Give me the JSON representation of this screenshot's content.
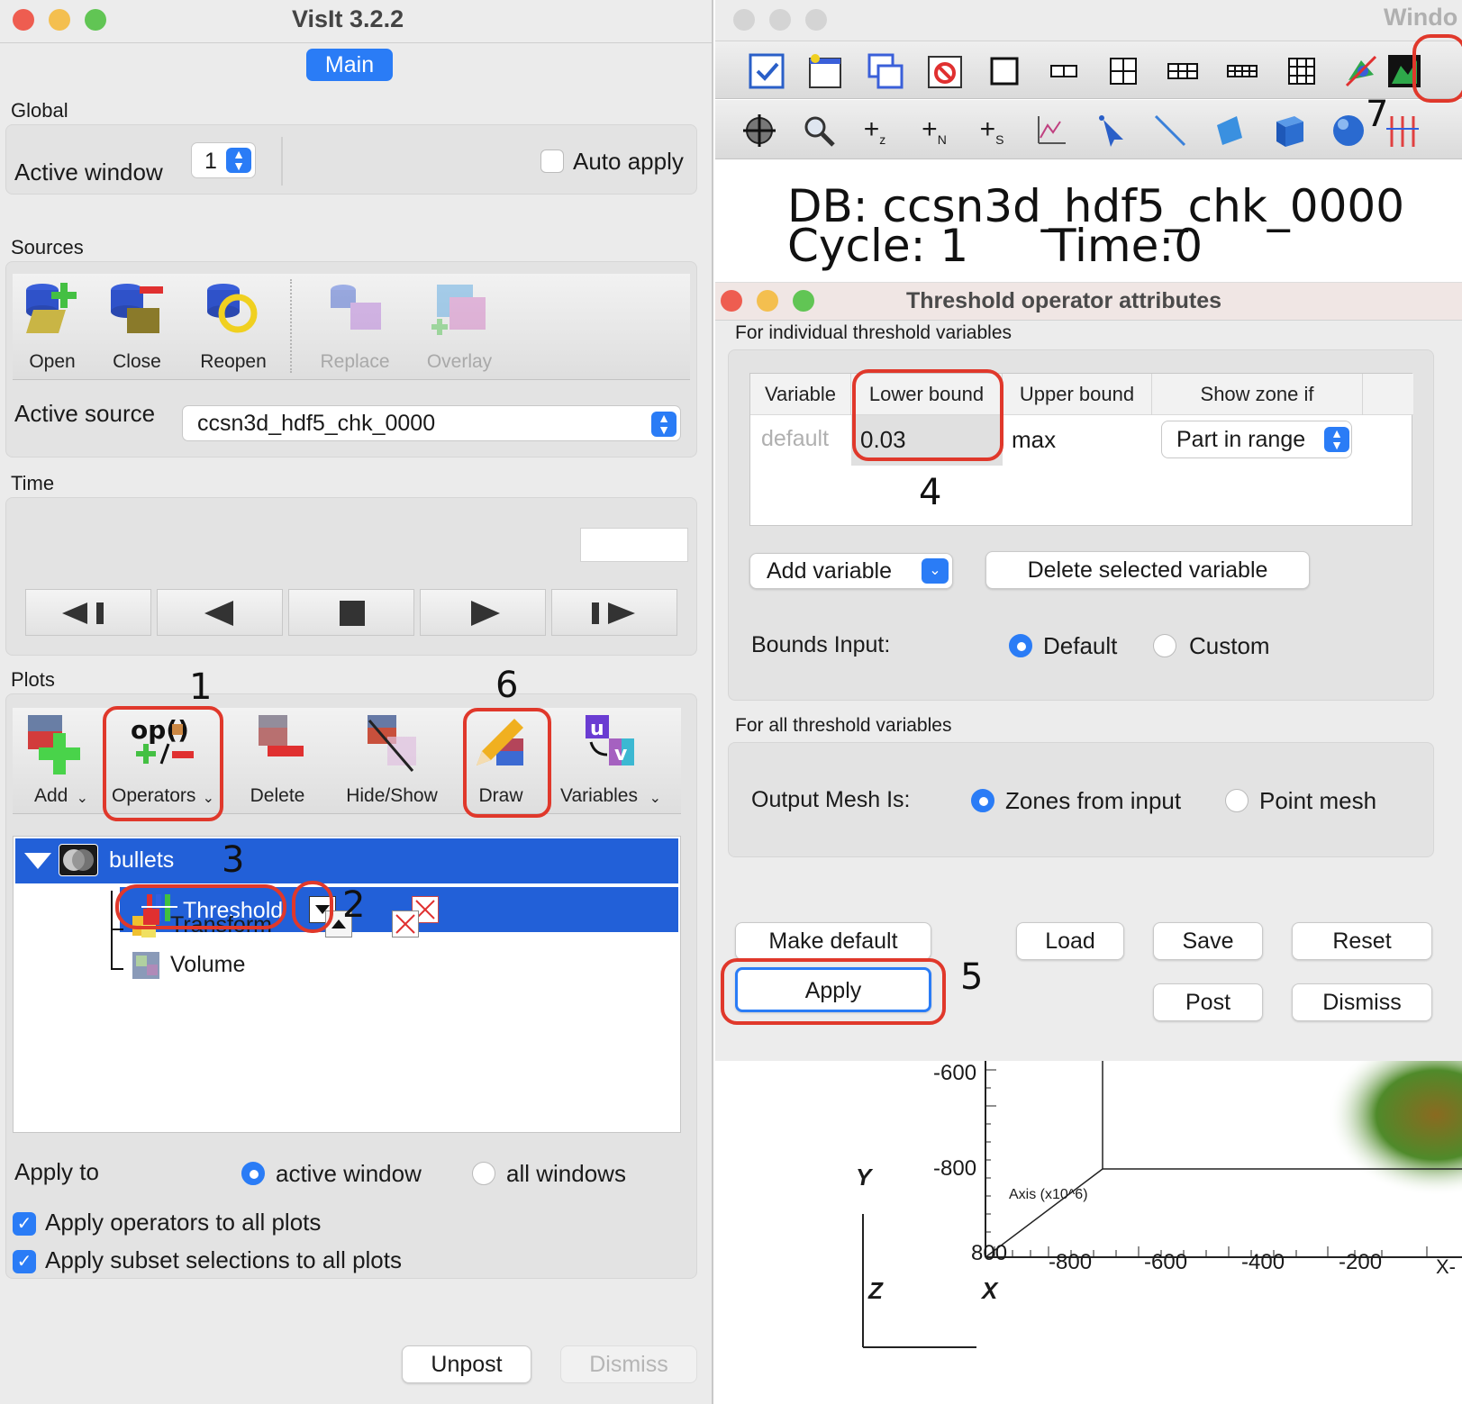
{
  "main_window": {
    "title": "VisIt 3.2.2",
    "tab": "Main",
    "global_label": "Global",
    "active_window_label": "Active window",
    "active_window_value": "1",
    "auto_apply_label": "Auto apply",
    "sources_label": "Sources",
    "sources_buttons": {
      "open": "Open",
      "close": "Close",
      "reopen": "Reopen",
      "replace": "Replace",
      "overlay": "Overlay"
    },
    "active_source_label": "Active source",
    "active_source_value": "ccsn3d_hdf5_chk_0000",
    "time_label": "Time",
    "plots_label": "Plots",
    "plot_buttons": {
      "add": "Add",
      "operators": "Operators",
      "delete": "Delete",
      "hideshow": "Hide/Show",
      "draw": "Draw",
      "variables": "Variables"
    },
    "plot_tree": {
      "plot": "bullets",
      "operators": [
        "Threshold",
        "Transform",
        "Volume"
      ]
    },
    "apply_to_label": "Apply to",
    "apply_active": "active window",
    "apply_all": "all windows",
    "apply_ops_all": "Apply operators to all plots",
    "apply_subset_all": "Apply subset selections to all plots",
    "unpost": "Unpost",
    "dismiss": "Dismiss"
  },
  "vis_window": {
    "title": "Windo",
    "db_line": "DB: ccsn3d_hdf5_chk_0000",
    "cycle_line": "Cycle: 1",
    "time_line": "Time:0",
    "y_ticks": [
      "-600",
      "-800"
    ],
    "x_ticks": [
      "-800",
      "-600",
      "-400",
      "-200",
      "800"
    ],
    "axis_y": "Y",
    "axis_x": "X",
    "axis_z": "Z",
    "axis_caption": "Axis (x10^6)",
    "x_axis_cut": "X-"
  },
  "dialog": {
    "title": "Threshold operator attributes",
    "section_individual": "For individual threshold variables",
    "col_variable": "Variable",
    "col_lower": "Lower bound",
    "col_upper": "Upper bound",
    "col_show": "Show zone if",
    "row_variable": "default",
    "row_lower": "0.03",
    "row_upper": "max",
    "row_show": "Part in range",
    "add_variable": "Add variable",
    "delete_variable": "Delete selected variable",
    "bounds_input_label": "Bounds Input:",
    "bounds_default": "Default",
    "bounds_custom": "Custom",
    "section_all": "For all threshold variables",
    "output_mesh_label": "Output Mesh Is:",
    "mesh_zones": "Zones from input",
    "mesh_point": "Point mesh",
    "make_default": "Make default",
    "load": "Load",
    "save": "Save",
    "reset": "Reset",
    "apply": "Apply",
    "post": "Post",
    "dismiss": "Dismiss"
  },
  "annotations": [
    "1",
    "2",
    "3",
    "4",
    "5",
    "6",
    "7"
  ],
  "colors": {
    "accent": "#2a7cf6",
    "selection": "#2260d8",
    "highlight_ring": "#e0382b"
  }
}
